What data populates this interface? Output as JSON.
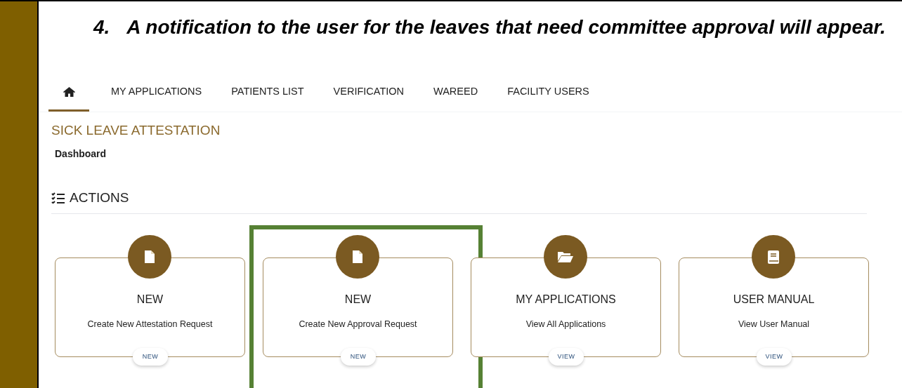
{
  "heading": {
    "number": "4.",
    "text": "A notification to the user for the leaves that need committee approval will appear."
  },
  "nav": [
    {
      "kind": "home",
      "selected": true
    },
    {
      "label": "MY APPLICATIONS",
      "kind": "text",
      "selected": false
    },
    {
      "label": "PATIENTS LIST",
      "kind": "text",
      "selected": false
    },
    {
      "label": "VERIFICATION",
      "kind": "text",
      "selected": false
    },
    {
      "label": "WAREED",
      "kind": "text",
      "selected": false
    },
    {
      "label": "FACILITY USERS",
      "kind": "text",
      "selected": false
    }
  ],
  "page_title": "SICK LEAVE ATTESTATION",
  "breadcrumb": "Dashboard",
  "section_title": "ACTIONS",
  "cards": [
    {
      "title": "NEW",
      "subtitle": "Create New Attestation Request",
      "button": "NEW",
      "highlighted": false
    },
    {
      "title": "NEW",
      "subtitle": "Create New Approval Request",
      "button": "NEW",
      "highlighted": true
    },
    {
      "title": "MY APPLICATIONS",
      "subtitle": "View All Applications",
      "button": "VIEW",
      "highlighted": false
    },
    {
      "title": "USER MANUAL",
      "subtitle": "View User Manual",
      "button": "VIEW",
      "highlighted": false
    }
  ]
}
